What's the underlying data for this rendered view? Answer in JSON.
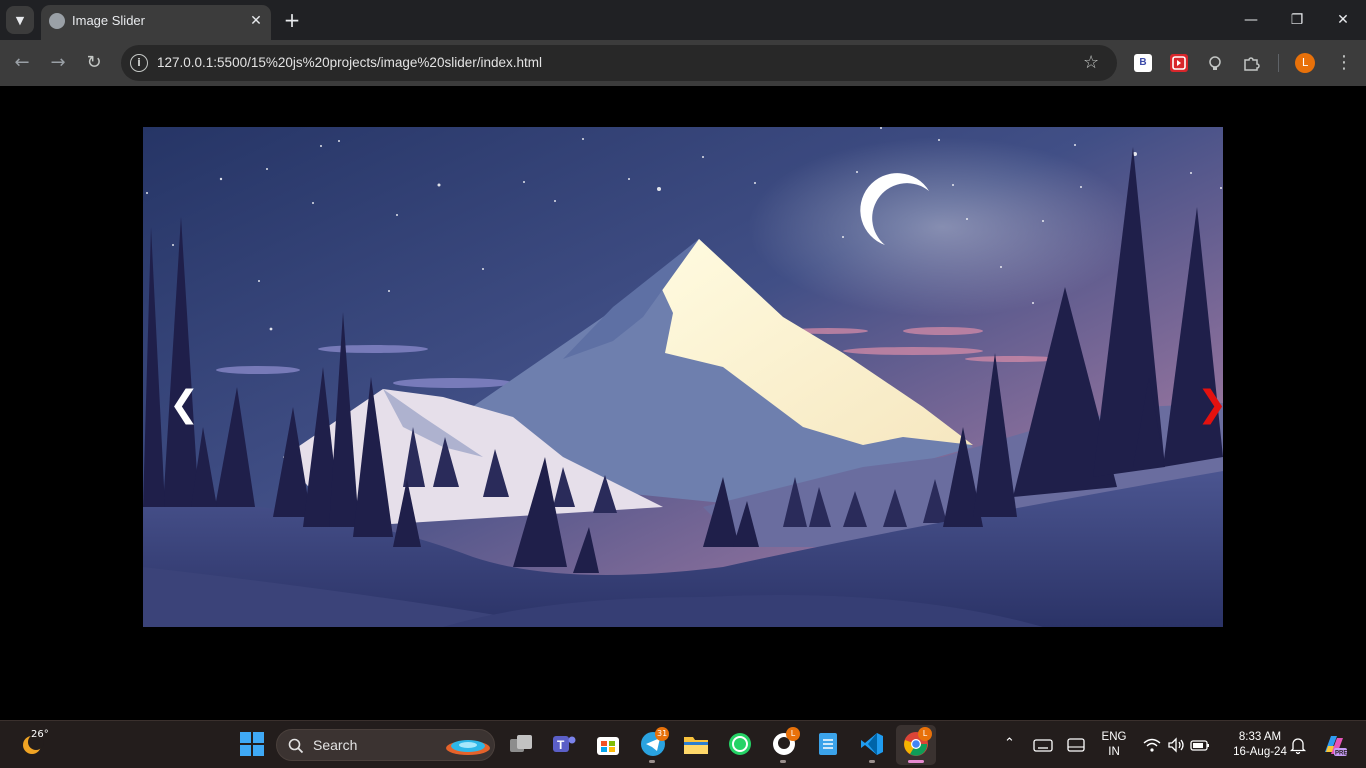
{
  "browser": {
    "tab_title": "Image Slider",
    "url": "127.0.0.1:5500/15%20js%20projects/image%20slider/index.html",
    "profile_initial": "L",
    "extensions": [
      {
        "name": "b-extension-icon",
        "label": "B"
      },
      {
        "name": "red-extension-icon",
        "label": ""
      },
      {
        "name": "bulb-extension-icon",
        "label": ""
      },
      {
        "name": "puzzle-extensions-icon",
        "label": ""
      }
    ]
  },
  "slider": {
    "prev_label": "❮",
    "next_label": "❯",
    "colors": {
      "prev": "#ffffff",
      "next": "#e3110f"
    }
  },
  "taskbar": {
    "weather_temp": "26°",
    "search_placeholder": "Search",
    "telegram_badge": "31",
    "github_badge": "L",
    "chrome_badge": "L",
    "lang_top": "ENG",
    "lang_bottom": "IN",
    "time": "8:33 AM",
    "date": "16-Aug-24"
  }
}
